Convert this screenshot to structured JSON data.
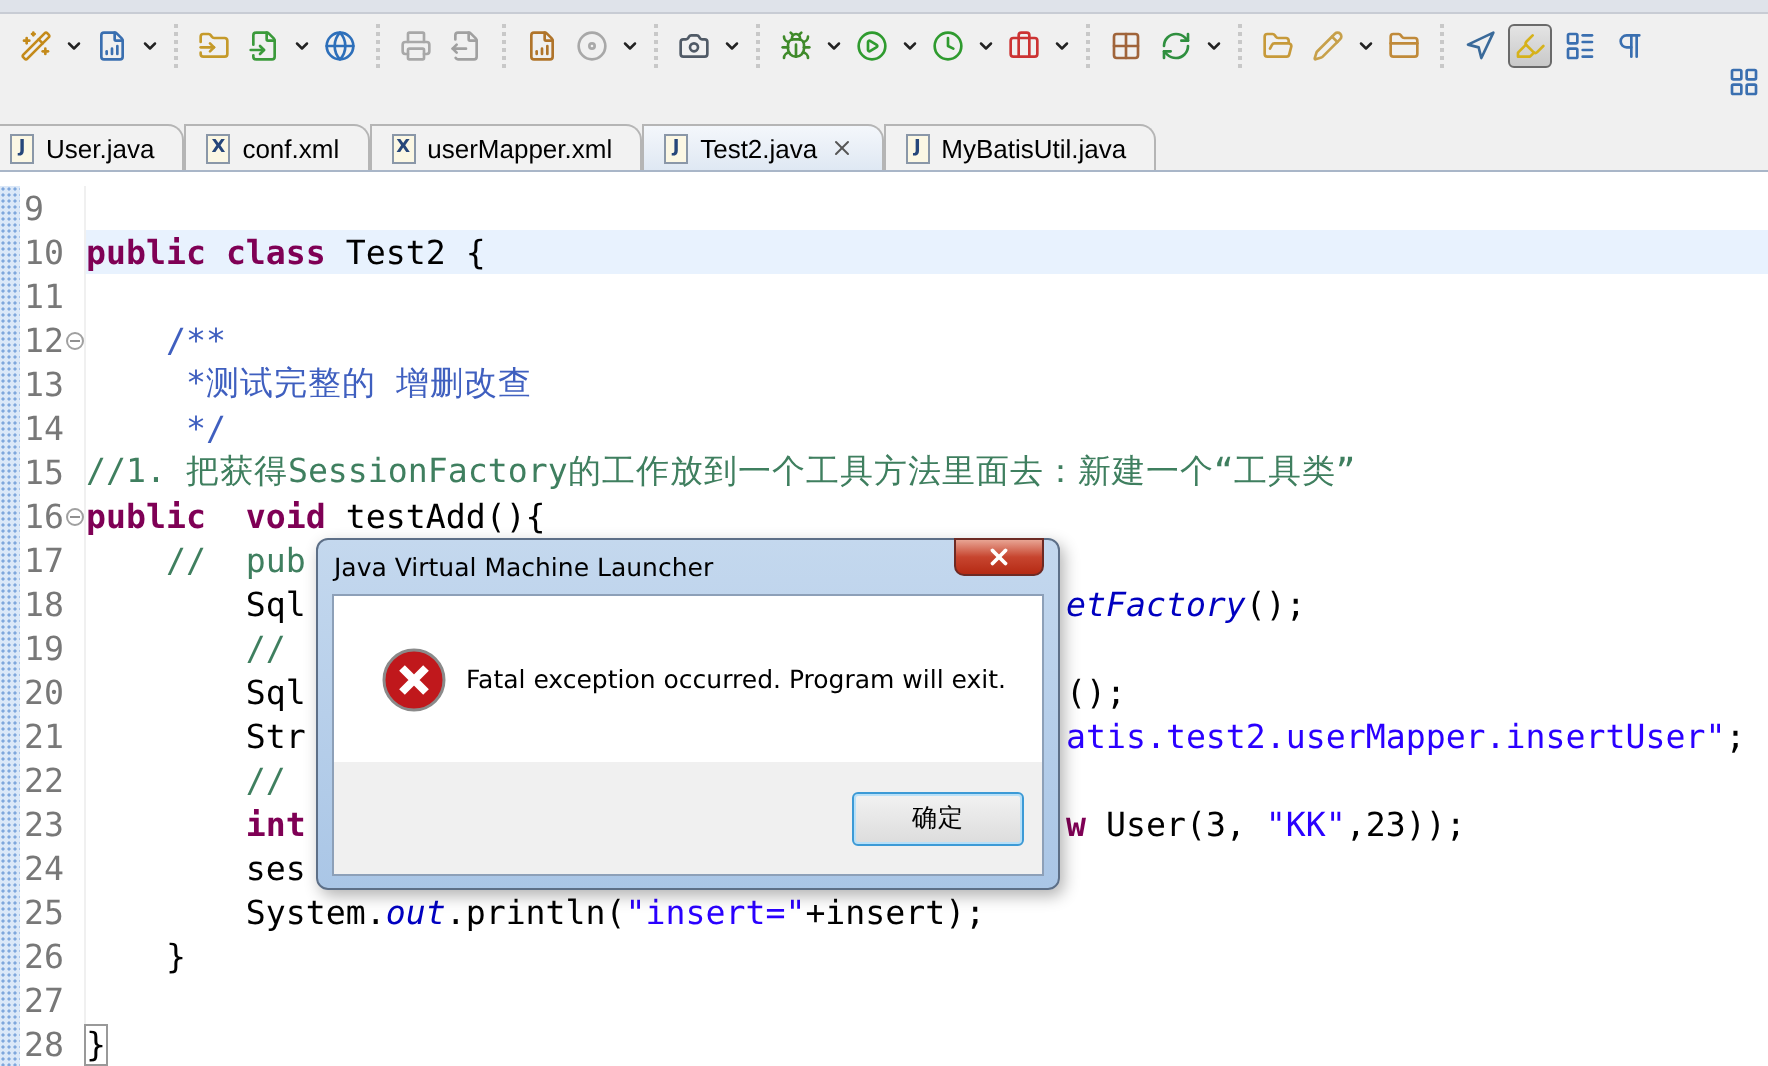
{
  "toolbar": {
    "groups": [
      [
        {
          "dropdown": true,
          "pressed": false
        },
        {
          "dropdown": true,
          "pressed": false
        }
      ],
      [
        {
          "dropdown": false,
          "pressed": false
        },
        {
          "dropdown": true,
          "pressed": false
        },
        {
          "dropdown": false,
          "pressed": false
        }
      ],
      [
        {
          "dropdown": false,
          "pressed": false
        },
        {
          "dropdown": false,
          "pressed": false
        }
      ],
      [
        {
          "dropdown": false,
          "pressed": false
        },
        {
          "dropdown": true,
          "pressed": false
        }
      ],
      [
        {
          "dropdown": true,
          "pressed": false
        }
      ],
      [
        {
          "dropdown": true,
          "pressed": false
        },
        {
          "dropdown": true,
          "pressed": false
        },
        {
          "dropdown": true,
          "pressed": false
        },
        {
          "dropdown": true,
          "pressed": false
        }
      ],
      [
        {
          "dropdown": false,
          "pressed": false
        },
        {
          "dropdown": true,
          "pressed": false
        }
      ],
      [
        {
          "dropdown": false,
          "pressed": false
        },
        {
          "dropdown": true,
          "pressed": false
        },
        {
          "dropdown": false,
          "pressed": false
        }
      ],
      [
        {
          "dropdown": false,
          "pressed": false
        },
        {
          "dropdown": false,
          "pressed": true
        },
        {
          "dropdown": false,
          "pressed": false
        },
        {
          "dropdown": false,
          "pressed": false
        }
      ]
    ]
  },
  "tabs": [
    {
      "badge": "J",
      "label": "User.java",
      "selected": false
    },
    {
      "badge": "X",
      "label": "conf.xml",
      "selected": false
    },
    {
      "badge": "X",
      "label": "userMapper.xml",
      "selected": false
    },
    {
      "badge": "J",
      "label": "Test2.java",
      "selected": true
    },
    {
      "badge": "J",
      "label": "MyBatisUtil.java",
      "selected": false
    }
  ],
  "editor": {
    "lines": [
      {
        "number": "9",
        "current": false,
        "foldable": false
      },
      {
        "number": "10",
        "current": true,
        "foldable": false,
        "tokens": [
          {
            "kind": "keyword",
            "text": "public"
          },
          {
            "kind": "keyword",
            "text": " class"
          },
          {
            "kind": "text",
            "text": " Test2 {"
          }
        ]
      },
      {
        "number": "11",
        "current": false,
        "foldable": false
      },
      {
        "number": "12",
        "current": false,
        "foldable": true,
        "tokens": [
          {
            "kind": "doc",
            "text": "    /**"
          }
        ]
      },
      {
        "number": "13",
        "current": false,
        "foldable": false,
        "tokens": [
          {
            "kind": "doc",
            "text": "     *测试完整的 增删改查"
          }
        ]
      },
      {
        "number": "14",
        "current": false,
        "foldable": false,
        "tokens": [
          {
            "kind": "doc",
            "text": "     */"
          }
        ]
      },
      {
        "number": "15",
        "current": false,
        "foldable": false,
        "tokens": [
          {
            "kind": "comment",
            "text": "//1. 把获得SessionFactory的工作放到一个工具方法里面去：新建一个“工具类”"
          }
        ]
      },
      {
        "number": "16",
        "current": false,
        "foldable": true,
        "tokens": [
          {
            "kind": "keyword",
            "text": "public"
          },
          {
            "kind": "keyword",
            "text": "  void"
          },
          {
            "kind": "text",
            "text": " testAdd(){"
          }
        ]
      },
      {
        "number": "17",
        "current": false,
        "foldable": false,
        "tokens": [
          {
            "kind": "comment",
            "text": "    //  pub"
          }
        ]
      },
      {
        "number": "18",
        "current": false,
        "foldable": false,
        "tokens": [
          {
            "kind": "text",
            "text": "        Sql"
          }
        ],
        "after_dialog": [
          {
            "kind": "static",
            "text": "etFactory"
          },
          {
            "kind": "text",
            "text": "();"
          }
        ]
      },
      {
        "number": "19",
        "current": false,
        "foldable": false,
        "tokens": [
          {
            "kind": "comment",
            "text": "        //"
          }
        ]
      },
      {
        "number": "20",
        "current": false,
        "foldable": false,
        "tokens": [
          {
            "kind": "text",
            "text": "        Sql"
          }
        ],
        "after_dialog": [
          {
            "kind": "text",
            "text": "();"
          }
        ]
      },
      {
        "number": "21",
        "current": false,
        "foldable": false,
        "tokens": [
          {
            "kind": "text",
            "text": "        Str"
          }
        ],
        "after_dialog": [
          {
            "kind": "string",
            "text": "atis.test2.userMapper.insertUser\""
          },
          {
            "kind": "text",
            "text": ";"
          }
        ]
      },
      {
        "number": "22",
        "current": false,
        "foldable": false,
        "tokens": [
          {
            "kind": "comment",
            "text": "        //"
          }
        ]
      },
      {
        "number": "23",
        "current": false,
        "foldable": false,
        "tokens": [
          {
            "kind": "keyword",
            "text": "        int"
          }
        ],
        "after_dialog": [
          {
            "kind": "keyword",
            "text": "w"
          },
          {
            "kind": "text",
            "text": " User(3, "
          },
          {
            "kind": "string",
            "text": "\"KK\""
          },
          {
            "kind": "text",
            "text": ",23));"
          }
        ]
      },
      {
        "number": "24",
        "current": false,
        "foldable": false,
        "tokens": [
          {
            "kind": "text",
            "text": "        ses"
          }
        ]
      },
      {
        "number": "25",
        "current": false,
        "foldable": false,
        "tokens": [
          {
            "kind": "text",
            "text": "        System."
          },
          {
            "kind": "static",
            "text": "out"
          },
          {
            "kind": "text",
            "text": ".println("
          },
          {
            "kind": "string",
            "text": "\"insert=\""
          },
          {
            "kind": "text",
            "text": "+insert);"
          }
        ]
      },
      {
        "number": "26",
        "current": false,
        "foldable": false,
        "tokens": [
          {
            "kind": "text",
            "text": "    }"
          }
        ]
      },
      {
        "number": "27",
        "current": false,
        "foldable": false
      },
      {
        "number": "28",
        "current": false,
        "foldable": false,
        "tokens": [
          {
            "kind": "text",
            "text": "}",
            "boxed": true
          }
        ]
      }
    ]
  },
  "dialog": {
    "title": "Java Virtual Machine Launcher",
    "message": "Fatal exception occurred.  Program will exit.",
    "button": "确定"
  }
}
